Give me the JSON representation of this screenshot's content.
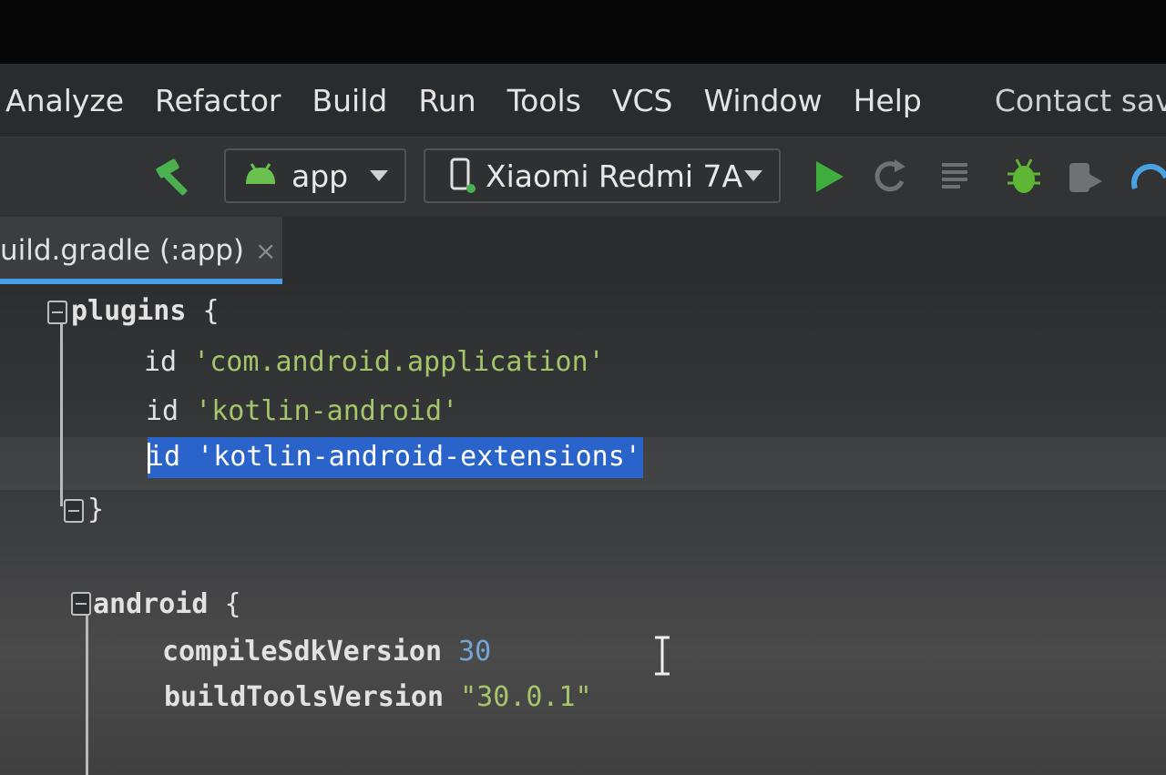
{
  "menu": {
    "items": [
      {
        "label": "Analyze"
      },
      {
        "label": "Refactor"
      },
      {
        "label": "Build"
      },
      {
        "label": "Run"
      },
      {
        "label": "Tools"
      },
      {
        "label": "VCS"
      },
      {
        "label": "Window"
      },
      {
        "label": "Help"
      }
    ],
    "window_title": "Contact saver - b"
  },
  "toolbar": {
    "run_config": "app",
    "device": "Xiaomi Redmi 7A",
    "icons": [
      "hammer-icon",
      "android-icon",
      "device-icon",
      "run-icon",
      "apply-changes-icon",
      "apply-code-changes-icon",
      "debug-icon",
      "attach-debugger-icon",
      "profiler-icon"
    ]
  },
  "tab": {
    "label": "uild.gradle (:app)",
    "close": "×"
  },
  "code": {
    "l1_kw": "plugins",
    "l1_brace": " {",
    "l2_id": "id",
    "l2_str": " 'com.android.application'",
    "l3_id": "id",
    "l3_str": " 'kotlin-android'",
    "l4_id": "id",
    "l4_str": " 'kotlin-android-extensions'",
    "l5_brace": "}",
    "l6_kw": "android",
    "l6_brace": " {",
    "l7_kw": "compileSdkVersion",
    "l7_num": " 30",
    "l8_kw": "buildToolsVersion",
    "l8_str": " \"30.0.1\""
  },
  "colors": {
    "accent_tab": "#4a9ee8",
    "selection": "#2a63c9",
    "string": "#a6c56b",
    "number": "#74a6d9",
    "run_green": "#3fae3f"
  }
}
